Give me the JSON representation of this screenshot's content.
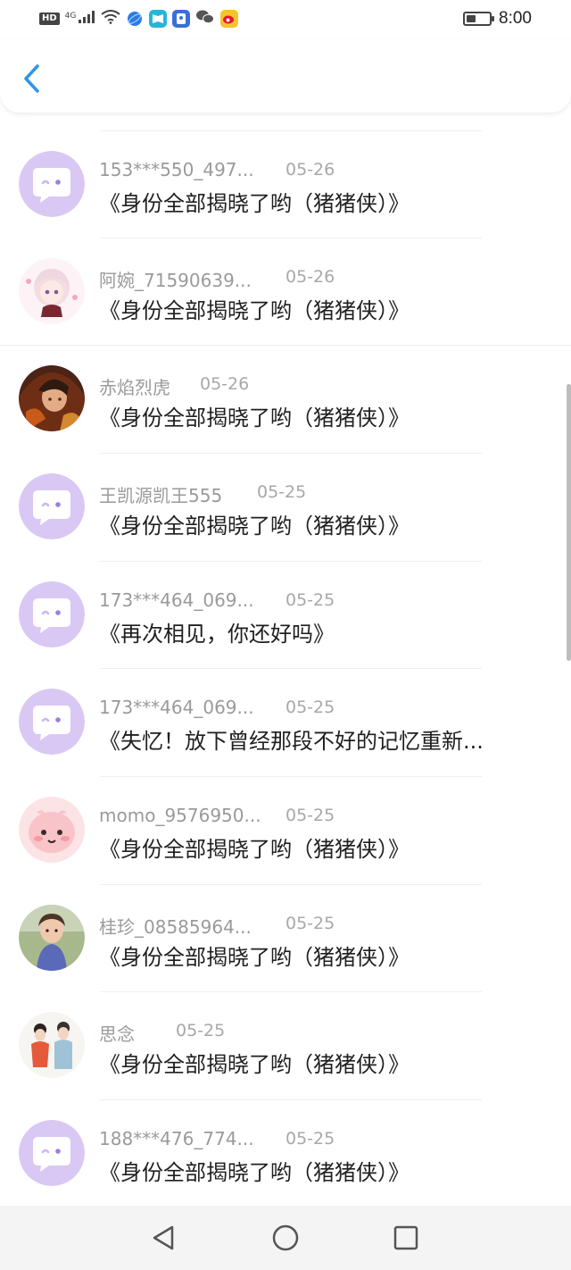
{
  "status_bar": {
    "hd": "HD",
    "network": "4G",
    "time": "8:00",
    "battery_level": 0.35,
    "icons": [
      "signal-icon",
      "wifi-icon",
      "browser-app-icon",
      "book-app-icon",
      "id-app-icon",
      "wechat-icon",
      "weibo-icon",
      "battery-icon"
    ]
  },
  "header": {
    "back_icon": "chevron-left-icon",
    "accent": "#2f95ea"
  },
  "comments": [
    {
      "user": "153***550_497...",
      "date": "05-26",
      "text": "《身份全部揭晓了哟（猪猪侠）》",
      "avatar": "default"
    },
    {
      "user": "阿婉_71590639...",
      "date": "05-26",
      "text": "《身份全部揭晓了哟（猪猪侠）》",
      "avatar": "anime-girl"
    },
    {
      "user": "赤焰烈虎",
      "date": "05-26",
      "text": "《身份全部揭晓了哟（猪猪侠）》",
      "avatar": "warrior"
    },
    {
      "user": "王凯源凯王555",
      "date": "05-25",
      "text": "《身份全部揭晓了哟（猪猪侠）》",
      "avatar": "default"
    },
    {
      "user": "173***464_069...",
      "date": "05-25",
      "text": "《再次相见，你还好吗》",
      "avatar": "default"
    },
    {
      "user": "173***464_069...",
      "date": "05-25",
      "text": "《失忆！放下曾经那段不好的记忆重新...",
      "avatar": "default"
    },
    {
      "user": "momo_9576950...",
      "date": "05-25",
      "text": "《身份全部揭晓了哟（猪猪侠）》",
      "avatar": "pink-creature"
    },
    {
      "user": "桂珍_08585964...",
      "date": "05-25",
      "text": "《身份全部揭晓了哟（猪猪侠）》",
      "avatar": "child-photo"
    },
    {
      "user": "思念",
      "date": "05-25",
      "text": "《身份全部揭晓了哟（猪猪侠）》",
      "avatar": "costume-couple"
    },
    {
      "user": "188***476_774...",
      "date": "05-25",
      "text": "《身份全部揭晓了哟（猪猪侠）》",
      "avatar": "default"
    }
  ],
  "nav_bar": {
    "icons": [
      "back-triangle-icon",
      "home-circle-icon",
      "recents-square-icon"
    ]
  },
  "colors": {
    "default_avatar": "#d9c8f3",
    "username": "#9a9a9a",
    "comment": "#1f1f1f"
  }
}
